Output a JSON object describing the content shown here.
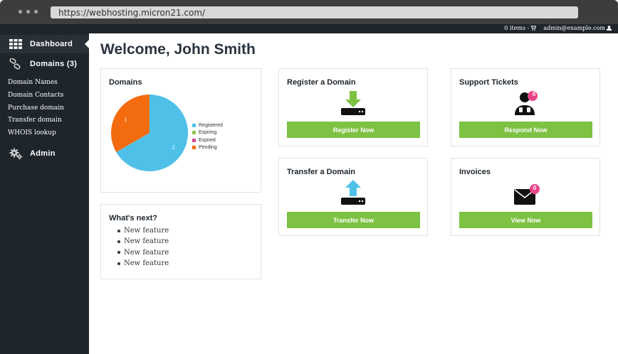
{
  "browser": {
    "url": "https://webhosting.micron21.com/"
  },
  "topbar": {
    "cart": "0 items - ",
    "user": "admin@example.com"
  },
  "sidebar": {
    "items": [
      {
        "label": "Dashboard",
        "icon": "grid-icon"
      },
      {
        "label": "Domains (3)",
        "icon": "link-icon"
      },
      {
        "label": "Admin",
        "icon": "gears-icon"
      }
    ],
    "domains_sub": [
      "Domain Names",
      "Domain Contacts",
      "Purchase domain",
      "Transfer domain",
      "WHOIS lookup"
    ]
  },
  "main": {
    "title": "Welcome, John Smith",
    "domains_card": {
      "title": "Domains"
    },
    "whats_next": {
      "title": "What's next?",
      "items": [
        "New feature",
        "New feature",
        "New feature",
        "New feature"
      ]
    },
    "register": {
      "title": "Register a Domain",
      "button": "Register Now",
      "icon": "download-drive-icon"
    },
    "transfer": {
      "title": "Transfer a Domain",
      "button": "Transfer Now",
      "icon": "upload-drive-icon"
    },
    "support": {
      "title": "Support Tickets",
      "button": "Respond Now",
      "badge": "0",
      "icon": "support-agent-icon"
    },
    "invoices": {
      "title": "Invoices",
      "button": "View Now",
      "badge": "0",
      "icon": "envelope-icon"
    }
  },
  "colors": {
    "accent_green": "#7dc242",
    "sidebar": "#1e252b",
    "badge": "#e8468a"
  },
  "chart_data": {
    "type": "pie",
    "title": "Domains",
    "categories": [
      "Registered",
      "Expiring",
      "Expired",
      "Pending"
    ],
    "values": [
      2,
      0,
      0,
      1
    ],
    "data_labels": [
      "2",
      "",
      "",
      "1"
    ],
    "colors": [
      "#4fc1e9",
      "#8cc152",
      "#d84a91",
      "#f26b0f"
    ],
    "legend": "right"
  }
}
